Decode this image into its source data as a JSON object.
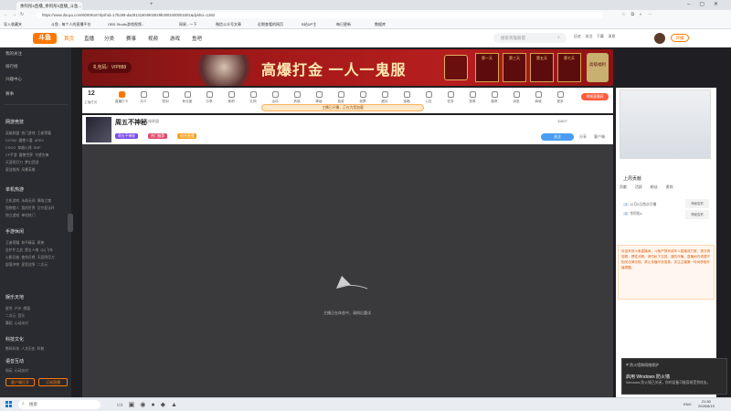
{
  "browser": {
    "tabs": [
      "余阿彤s直播_余阿彤s直播_斗鱼...",
      ""
    ],
    "url": "https://www.douyu.com/6000616?dyshid=17b269-da28131804902629b3002400001501&dyshci=1282",
    "bookmarks": [
      "导入收藏夹",
      "斗鱼 - 每个人的直播平台",
      "OBS Studio游戏视频...",
      "网易 - 一下",
      "微信公众号文章",
      "近期查看的网页",
      "B站UP主",
      "每日更新",
      "数据库"
    ]
  },
  "site": {
    "logo": "斗鱼",
    "nav": [
      "首页",
      "直播",
      "分类",
      "赛事",
      "视频",
      "游戏",
      "鱼吧"
    ],
    "search_placeholder": "搜索英雄联盟",
    "user_actions": [
      "历史",
      "关注",
      "下载",
      "消息",
      "开播"
    ]
  },
  "sidebar": {
    "top_items": [
      "我的关注",
      "排行榜",
      "兴趣中心",
      "赛事"
    ],
    "sections": [
      {
        "title": "网游竞技",
        "items": [
          "英雄联盟",
          "热门游戏",
          "王者荣耀",
          "DOTA2",
          "魔兽人喜",
          "APEX",
          "CSGO",
          "穿越火线",
          "DNF",
          "CF手游",
          "魔兽世界",
          "守望先锋",
          "天涯明月刀",
          "梦幻西游",
          "星战前线",
          "风暴英雄"
        ]
      },
      {
        "title": "单机热游",
        "items": [
          "主机游戏",
          "永劫无间",
          "黑暗之魂",
          "怪物猎人",
          "我的世界",
          "艾尔登法环",
          "独立游戏",
          "单机热门"
        ]
      },
      {
        "title": "手游休闲",
        "items": [
          "王者荣耀",
          "和平精英",
          "原神",
          "金铲铲之战",
          "第五人格",
          "QQ飞车",
          "火影忍者",
          "使命召唤",
          "天涯明月刀",
          "部落冲突",
          "皇室战争",
          "二次元"
        ]
      },
      {
        "title": "娱乐天地",
        "items": [
          "星秀",
          "户外",
          "颜值",
          "二次元",
          "音乐",
          "舞蹈",
          "心动派对"
        ]
      },
      {
        "title": "科技文化",
        "items": [
          "数码科技",
          "人文历史",
          "科普"
        ]
      },
      {
        "title": "语音互动",
        "items": [
          "陪玩",
          "心动派对"
        ]
      }
    ],
    "bottom_buttons": [
      "客户端打开",
      "订阅直播"
    ]
  },
  "banner": {
    "code_label": "礼包码：VIP888",
    "slogan": "高爆打金 一人一鬼服",
    "days": [
      "第一天",
      "第三天",
      "第五天",
      "第七天"
    ],
    "right_badge": "高级福利"
  },
  "icon_row": {
    "count": "12",
    "count_label": "主播任务",
    "items": [
      "直播打卡",
      "月卡",
      "签到",
      "粉丝团",
      "分享",
      "鱼吧",
      "礼物",
      "活动",
      "贵族",
      "等级",
      "抽奖",
      "投票",
      "舰队",
      "宝箱",
      "公告",
      "任务",
      "勋章",
      "徽章",
      "消息",
      "商城",
      "更多"
    ],
    "report_button": "举报直播间",
    "notice": "主播已开播，正在为您加载"
  },
  "streamer": {
    "name": "周五不神秘",
    "category": "英雄联盟",
    "tags": [
      "周五不神秘",
      "热门推荐",
      "综合直播"
    ],
    "followers": "11607",
    "follow_button": "关注",
    "actions": [
      "分享",
      "客户端"
    ]
  },
  "player": {
    "message": "主播正在休息中，请稍后重试"
  },
  "rightcol": {
    "gift_title": "上周贡献",
    "tabs": [
      "贡献",
      "活跃",
      "粉丝",
      "贵宾"
    ],
    "ranks": [
      {
        "name": "12月5日首次开播",
        "value": ""
      },
      {
        "name": "余阿彤s",
        "value": ""
      }
    ],
    "side_badges": [
      "神秘嘉宾",
      "神秘嘉宾"
    ],
    "notice": "欢迎来到斗鱼直播间，斗鱼严禁未成年人直播或打赏。请文明观看，理性消费。请勿私下交易，谨防诈骗。直播间内请遵守相关法律法规，禁止传播不良信息。关注主播第一时间获取开播提醒。"
  },
  "toast": {
    "title": "防火墙和网络保护",
    "heading": "启用 Windows 防火墙",
    "body": "Windows 防火墙已关闭，你的设备可能容易受到攻击。"
  },
  "taskbar": {
    "search": "搜索",
    "time": "21:50",
    "date": "2025/8/19",
    "lang": "ENG"
  },
  "colors": {
    "brand": "#ff7700",
    "banner": "#a01818",
    "sidebar": "#2a2b30",
    "player": "#3a3a3d"
  }
}
